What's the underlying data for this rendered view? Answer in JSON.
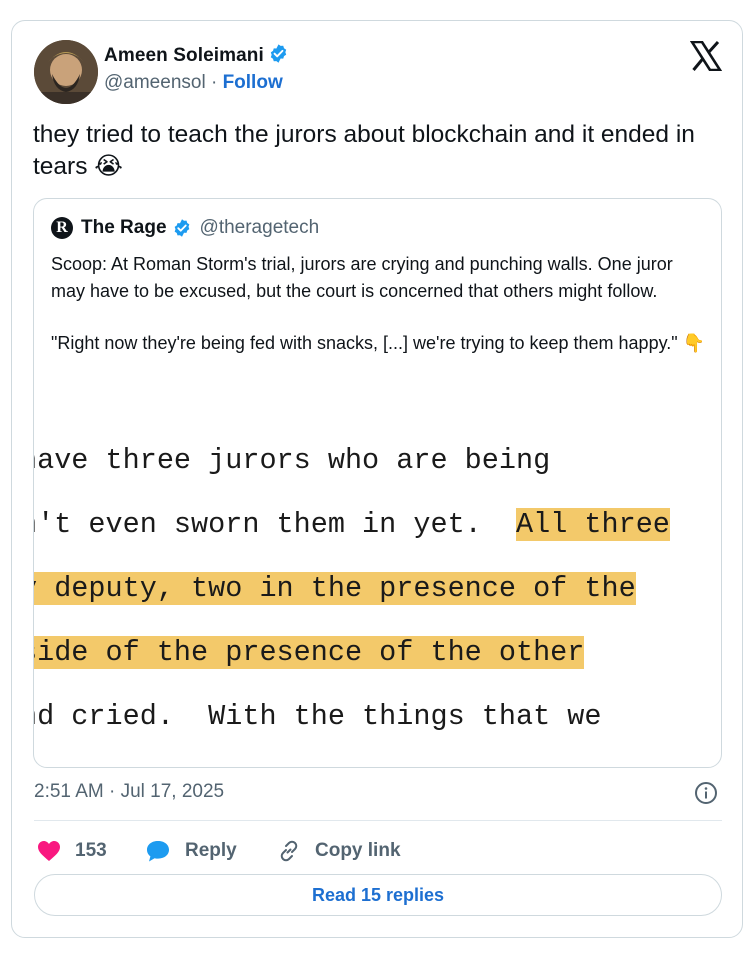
{
  "author": {
    "name": "Ameen Soleimani",
    "handle": "@ameensol",
    "separator": "·",
    "follow_label": "Follow"
  },
  "tweet": {
    "text": "they tried to teach the jurors about blockchain and it ended in tears 😭"
  },
  "quote": {
    "name": "The Rage",
    "logo_letter": "R",
    "handle": "@theragetech",
    "paragraph1": "Scoop: At Roman Storm's trial, jurors are crying and punching walls. One juror may have to be excused, but the court is concerned that others might follow.",
    "paragraph2": "\"Right now they're being fed with snacks, [...] we're trying to keep them happy.\" 👇",
    "transcript": {
      "line1": "have three jurors who are being",
      "line2_plain": "n't even sworn them in yet.  ",
      "line2_highlight": "All three",
      "line3_highlight": "y deputy, two in the presence of the",
      "line4_highlight": "side of the presence of the other",
      "line5": "nd cried.  With the things that we"
    }
  },
  "meta": {
    "timestamp": "2:51 AM · Jul 17, 2025"
  },
  "actions": {
    "like_count": "153",
    "reply_label": "Reply",
    "copy_label": "Copy link"
  },
  "footer": {
    "read_replies_label": "Read 15 replies"
  },
  "colors": {
    "accent": "#1d6fd1",
    "verified": "#1d9bf0",
    "like": "#f91880",
    "highlight": "#f3c96a"
  },
  "icons": [
    "avatar",
    "verified-badge-icon",
    "x-logo-icon",
    "info-icon",
    "heart-icon",
    "reply-bubble-icon",
    "link-icon"
  ]
}
